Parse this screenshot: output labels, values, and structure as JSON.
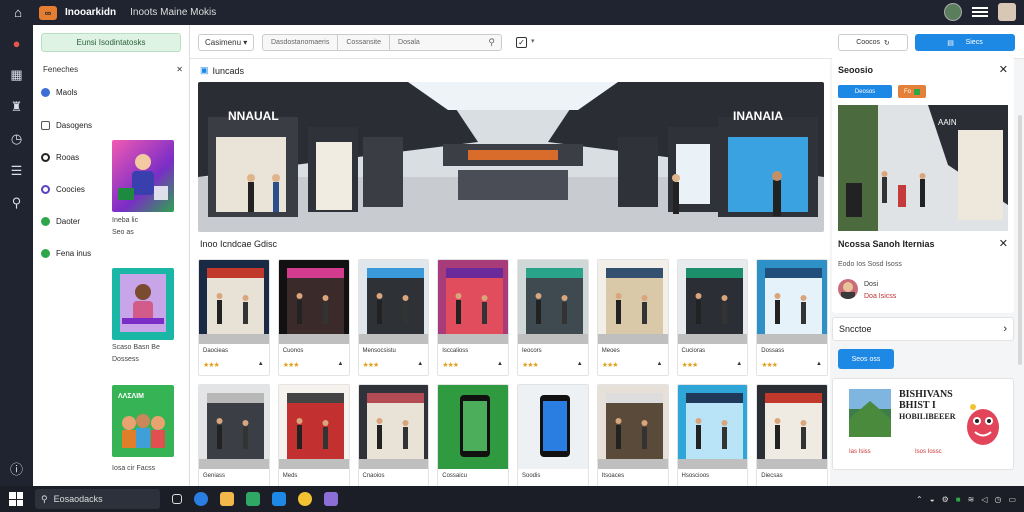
{
  "titlebar": {
    "app_name": "Inooarkidn",
    "app_sub": "Inoots Maine Mokis"
  },
  "sidebar": {
    "new_button": "Eunsi Isodintatosks",
    "section": "Feneches",
    "items": [
      {
        "label": "Maols",
        "color": "#3b6fd6"
      },
      {
        "label": "Dasogens",
        "color": "#555"
      },
      {
        "label": "Rooas",
        "color": "#222"
      },
      {
        "label": "Coocies",
        "color": "#5a3fc0"
      },
      {
        "label": "Daoter",
        "color": "#2ea64a"
      },
      {
        "label": "Fena inus",
        "color": "#2ea64a"
      }
    ],
    "captions": [
      [
        "Ineba lic",
        "Seo as"
      ],
      [
        "Scaso Basn Be",
        "Dossess"
      ],
      [
        "Iosa cir Facss"
      ]
    ]
  },
  "toolbar": {
    "filter_label": "Casimenu",
    "search_seg1": "Dasdostanomaeris",
    "search_seg2": "Cossansite",
    "search_seg3": "Dosala"
  },
  "main": {
    "section1_title": "Iuncads",
    "section2_title": "Inoo Icndcae Gdisc",
    "cards_row1": [
      "Daocieas",
      "Cuonos",
      "Mensocsistu",
      "Isccalioss",
      "Ieocors",
      "Meoes",
      "Cucioras",
      "Dossass"
    ],
    "cards_row2": [
      "Geniass",
      "Meds",
      "Cnaoios",
      "Cossaicu",
      "Soodis",
      "Itsoaces",
      "Hsoscioos",
      "Diecsas"
    ],
    "stars": "★★★"
  },
  "rpanel": {
    "btn1": "Coocos",
    "btn2": "Siecs",
    "card1_title": "Seoosio",
    "tag1": "Deosos",
    "tag2": "Fo",
    "card2_title": "Ncossa Sanoh Iternias",
    "card2_sub": "Eodo Ios Sosd Isoss",
    "card2_user1": "Dosi",
    "card2_user2": "Doa Isicss",
    "card3_title": "Sncctoe",
    "primary_btn": "Seos oss",
    "promo_line1": "BISHIVANS",
    "promo_line2": "BHIST I",
    "promo_line3": "HOBILIBEEER",
    "promo_cap1": "Ias Isiss",
    "promo_cap2": "Isos Iossc"
  },
  "taskbar": {
    "search_text": "Eosaodacks"
  },
  "colors": {
    "accent": "#1e88e5",
    "dark": "#1f2430",
    "green": "#2ea64a"
  }
}
